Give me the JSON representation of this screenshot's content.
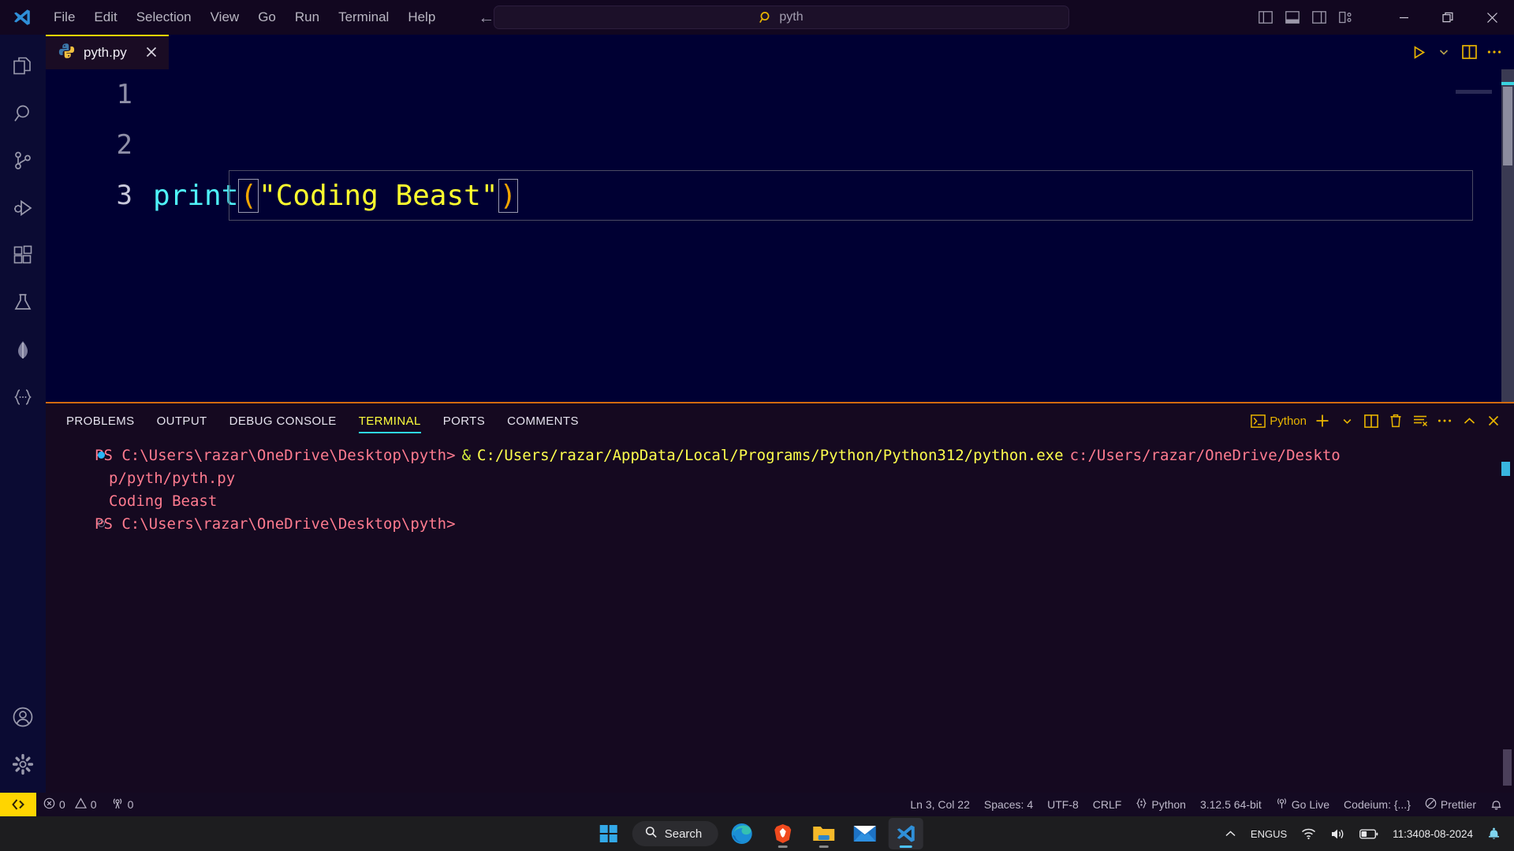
{
  "app": {
    "name": "Visual Studio Code",
    "logo_icon": "vscode-logo-icon"
  },
  "titlebar": {
    "menu": [
      {
        "label": "File"
      },
      {
        "label": "Edit"
      },
      {
        "label": "Selection"
      },
      {
        "label": "View"
      },
      {
        "label": "Go"
      },
      {
        "label": "Run"
      },
      {
        "label": "Terminal"
      },
      {
        "label": "Help"
      }
    ],
    "nav": {
      "back": "←",
      "forward": "→"
    },
    "search": {
      "value": "pyth",
      "icon": "search-icon",
      "accent": "#e8b400"
    },
    "layout_buttons": [
      {
        "name": "toggle-primary-sidebar",
        "icon": "layout-sidebar-left-icon"
      },
      {
        "name": "toggle-panel",
        "icon": "layout-panel-icon"
      },
      {
        "name": "toggle-secondary-sidebar",
        "icon": "layout-sidebar-right-icon"
      },
      {
        "name": "customize-layout",
        "icon": "layout-customize-icon"
      }
    ],
    "window_buttons": [
      {
        "name": "minimize",
        "icon": "minimize-icon"
      },
      {
        "name": "maximize",
        "icon": "restore-icon"
      },
      {
        "name": "close",
        "icon": "close-icon"
      }
    ]
  },
  "activitybar": {
    "top": [
      {
        "name": "explorer",
        "icon": "files-icon"
      },
      {
        "name": "search",
        "icon": "search-icon"
      },
      {
        "name": "source-control",
        "icon": "source-control-icon"
      },
      {
        "name": "run-and-debug",
        "icon": "run-debug-icon"
      },
      {
        "name": "extensions",
        "icon": "extensions-icon"
      },
      {
        "name": "testing",
        "icon": "beaker-icon"
      },
      {
        "name": "mongodb",
        "icon": "mongodb-leaf-icon"
      },
      {
        "name": "snippets",
        "icon": "curly-braces-icon"
      }
    ],
    "bottom": [
      {
        "name": "accounts",
        "icon": "account-circle-icon"
      },
      {
        "name": "manage-settings",
        "icon": "gear-icon"
      }
    ]
  },
  "editor": {
    "tab": {
      "label": "pyth.py",
      "icon": "python-file-icon",
      "close_icon": "close-icon",
      "active_border": "#ffd500"
    },
    "actions": [
      {
        "name": "run-python-file",
        "icon": "run-triangle-icon"
      },
      {
        "name": "run-options",
        "icon": "chevron-down-icon"
      },
      {
        "name": "split-editor-right",
        "icon": "split-editor-icon"
      },
      {
        "name": "more-actions",
        "icon": "ellipsis-icon"
      }
    ],
    "line_numbers": [
      "1",
      "2",
      "3"
    ],
    "code": {
      "line3": {
        "fn": "print",
        "open_paren": "(",
        "string": "\"Coding Beast\"",
        "close_paren": ")"
      }
    },
    "background": "#000033",
    "colors": {
      "function": "#4ff3f9",
      "string": "#ffff2e",
      "paren": "#f0a500"
    }
  },
  "panel": {
    "tabs": [
      {
        "label": "PROBLEMS",
        "active": false
      },
      {
        "label": "OUTPUT",
        "active": false
      },
      {
        "label": "DEBUG CONSOLE",
        "active": false
      },
      {
        "label": "TERMINAL",
        "active": true
      },
      {
        "label": "PORTS",
        "active": false
      },
      {
        "label": "COMMENTS",
        "active": false
      }
    ],
    "actions": {
      "shell_label": "Python",
      "shell_icon": "terminal-icon",
      "buttons": [
        {
          "name": "new-terminal",
          "icon": "plus-icon"
        },
        {
          "name": "terminal-profile-dropdown",
          "icon": "chevron-down-icon"
        },
        {
          "name": "split-terminal",
          "icon": "split-icon"
        },
        {
          "name": "kill-terminal",
          "icon": "trash-icon"
        },
        {
          "name": "clear-terminal",
          "icon": "clear-all-icon"
        },
        {
          "name": "terminal-more-actions",
          "icon": "ellipsis-icon"
        },
        {
          "name": "maximize-panel",
          "icon": "chevron-up-icon"
        },
        {
          "name": "close-panel",
          "icon": "close-icon"
        }
      ]
    },
    "terminal": {
      "line1": {
        "prompt": "PS C:\\Users\\razar\\OneDrive\\Desktop\\pyth>",
        "amp": "&",
        "interpreter": "C:/Users/razar/AppData/Local/Programs/Python/Python312/python.exe",
        "script": "c:/Users/razar/OneDrive/Deskto"
      },
      "line2": "p/pyth/pyth.py",
      "line3": "Coding Beast",
      "line4": {
        "prompt": "PS C:\\Users\\razar\\OneDrive\\Desktop\\pyth>"
      }
    }
  },
  "statusbar": {
    "remote_icon": "remote-window-icon",
    "left": [
      {
        "name": "errors",
        "icon": "error-circle-icon",
        "value": "0"
      },
      {
        "name": "warnings",
        "icon": "warning-triangle-icon",
        "value": "0"
      },
      {
        "name": "ports",
        "icon": "radio-tower-icon",
        "value": "0"
      }
    ],
    "right": [
      {
        "name": "cursor-position",
        "label": "Ln 3, Col 22"
      },
      {
        "name": "indentation",
        "label": "Spaces: 4"
      },
      {
        "name": "encoding",
        "label": "UTF-8"
      },
      {
        "name": "eol",
        "label": "CRLF"
      },
      {
        "name": "language-mode",
        "label": "Python",
        "icon": "python-brace-icon"
      },
      {
        "name": "python-interpreter",
        "label": "3.12.5 64-bit"
      },
      {
        "name": "go-live",
        "label": "Go Live",
        "icon": "broadcast-icon"
      },
      {
        "name": "codeium",
        "label": "Codeium: {...}"
      },
      {
        "name": "prettier",
        "label": "Prettier",
        "icon": "prettier-icon"
      },
      {
        "name": "notifications",
        "label": "",
        "icon": "bell-icon"
      }
    ]
  },
  "taskbar": {
    "apps": [
      {
        "name": "start",
        "icon": "windows-start-icon"
      },
      {
        "name": "search",
        "icon": "search-icon",
        "label": "Search"
      },
      {
        "name": "edge",
        "icon": "edge-icon"
      },
      {
        "name": "brave",
        "icon": "brave-icon"
      },
      {
        "name": "file-explorer",
        "icon": "folder-icon"
      },
      {
        "name": "mail",
        "icon": "mail-icon"
      },
      {
        "name": "vscode",
        "icon": "vscode-logo-icon"
      }
    ],
    "tray": {
      "overflow_icon": "chevron-up-icon",
      "language": "ENG",
      "region": "US",
      "wifi_icon": "wifi-icon",
      "volume_icon": "volume-icon",
      "battery_icon": "battery-icon",
      "time": "11:34",
      "date": "08-08-2024",
      "notification_icon": "bell-icon"
    }
  }
}
